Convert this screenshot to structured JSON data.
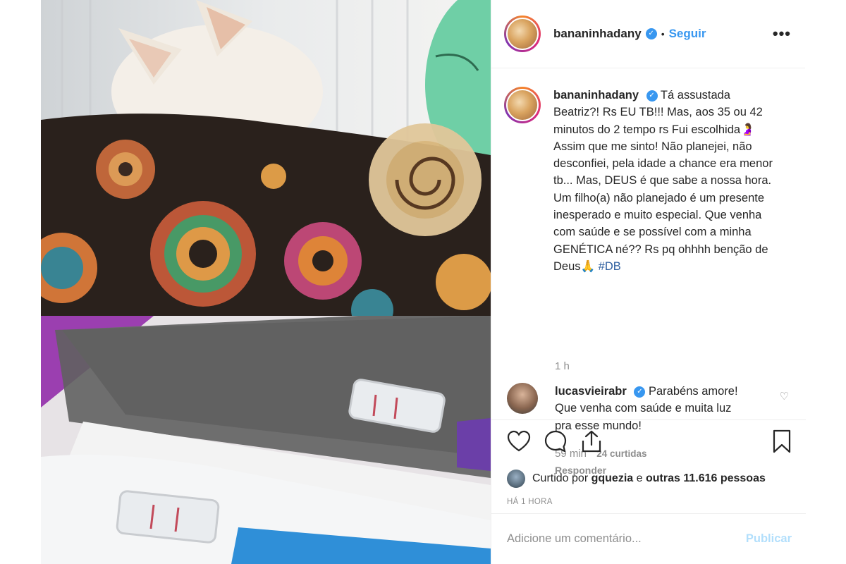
{
  "header": {
    "username": "bananinhadany",
    "separator": "•",
    "follow_label": "Seguir",
    "more_label": "•••"
  },
  "caption": {
    "username": "bananinhadany",
    "text": "Tá assustada Beatriz?! Rs EU TB!!! Mas, aos 35 ou 42 minutos do 2 tempo rs Fui escolhida🤰 Assim que me sinto! Não planejei, não desconfiei, pela idade a chance era menor tb... Mas, DEUS é que sabe a nossa hora. Um filho(a) não planejado é um presente inesperado e muito especial. Que venha com saúde e se possível com a minha GENÉTICA né?? Rs pq ohhhh benção de Deus🙏",
    "hashtag": "#DB",
    "time": "1 h"
  },
  "reply": {
    "username": "lucasvieirabr",
    "text": "Parabéns amore! Que venha com saúde e muita luz pra esse mundo!",
    "time": "59 min",
    "likes": "24 curtidas",
    "reply_label": "Responder"
  },
  "likes": {
    "prefix": "Curtido por",
    "user": "gquezia",
    "middle": "e",
    "others": "outras 11.616 pessoas"
  },
  "posted_time": "HÁ 1 HORA",
  "comment_box": {
    "placeholder": "Adicione um comentário...",
    "publish_label": "Publicar"
  },
  "colors": {
    "accent": "#3897f0",
    "hashtag": "#2e5fa0",
    "muted": "#8e8e8e",
    "publish_disabled": "#b2dffc"
  }
}
